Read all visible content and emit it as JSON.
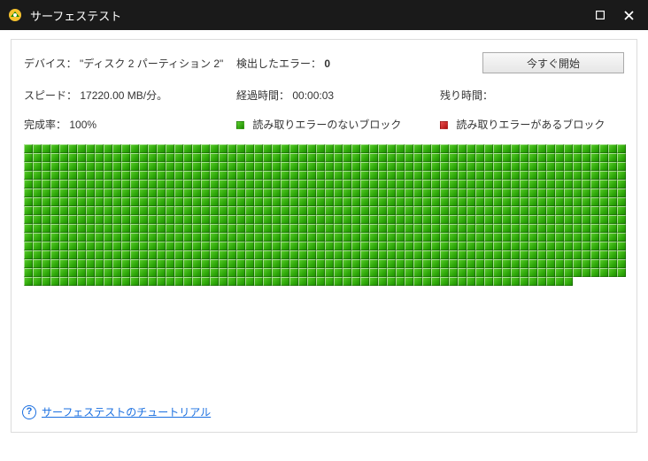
{
  "window": {
    "title": "サーフェステスト"
  },
  "info": {
    "device_label": "デバイス：",
    "device_value": "\"ディスク 2 パーティション 2\"",
    "errors_label": "検出したエラー：",
    "errors_value": "0",
    "start_button": "今すぐ開始",
    "speed_label": "スピード：",
    "speed_value": "17220.00 MB/分。",
    "elapsed_label": "経過時間：",
    "elapsed_value": "00:00:03",
    "remaining_label": "残り時間：",
    "remaining_value": "",
    "completion_label": "完成率：",
    "completion_value": "100%",
    "legend_ok": "読み取りエラーのないブロック",
    "legend_err": "読み取りエラーがあるブロック"
  },
  "blocks": {
    "columns": 68,
    "full_rows": 15,
    "last_row_count": 62
  },
  "footer": {
    "help_glyph": "?",
    "tutorial_link": "サーフェステストのチュートリアル"
  }
}
